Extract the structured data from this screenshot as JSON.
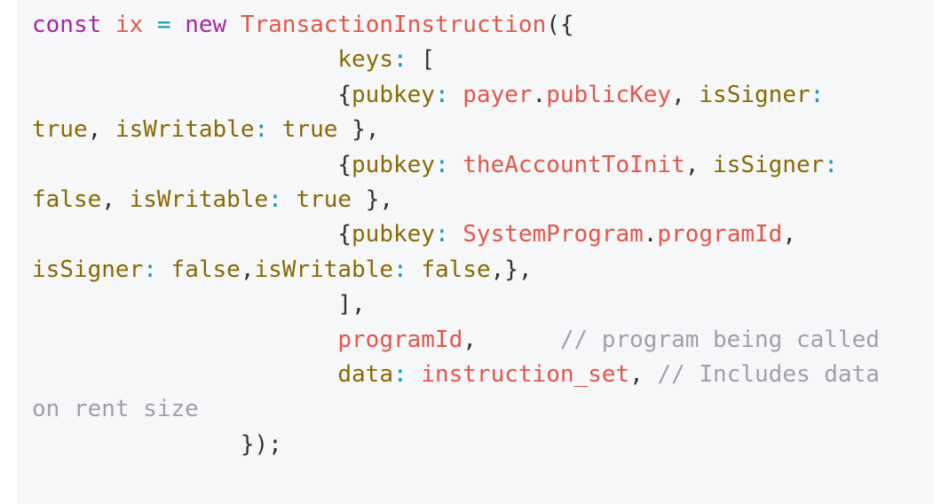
{
  "code": {
    "language": "javascript",
    "lines": [
      [
        {
          "t": "const",
          "c": "kw"
        },
        {
          "t": " ",
          "c": "punc"
        },
        {
          "t": "ix",
          "c": "var"
        },
        {
          "t": " ",
          "c": "punc"
        },
        {
          "t": "=",
          "c": "op"
        },
        {
          "t": " ",
          "c": "punc"
        },
        {
          "t": "new",
          "c": "kw"
        },
        {
          "t": " ",
          "c": "punc"
        },
        {
          "t": "TransactionInstruction",
          "c": "var"
        },
        {
          "t": "({",
          "c": "punc"
        }
      ],
      [
        {
          "t": "                      ",
          "c": "punc"
        },
        {
          "t": "keys",
          "c": "prop"
        },
        {
          "t": ":",
          "c": "op"
        },
        {
          "t": " [",
          "c": "punc"
        }
      ],
      [
        {
          "t": "                      ",
          "c": "punc"
        },
        {
          "t": "{",
          "c": "punc"
        },
        {
          "t": "pubkey",
          "c": "prop"
        },
        {
          "t": ":",
          "c": "op"
        },
        {
          "t": " ",
          "c": "punc"
        },
        {
          "t": "payer",
          "c": "var"
        },
        {
          "t": ".",
          "c": "punc"
        },
        {
          "t": "publicKey",
          "c": "var"
        },
        {
          "t": ", ",
          "c": "punc"
        },
        {
          "t": "isSigner",
          "c": "prop"
        },
        {
          "t": ":",
          "c": "op"
        }
      ],
      [
        {
          "t": "true",
          "c": "prop"
        },
        {
          "t": ", ",
          "c": "punc"
        },
        {
          "t": "isWritable",
          "c": "prop"
        },
        {
          "t": ":",
          "c": "op"
        },
        {
          "t": " ",
          "c": "punc"
        },
        {
          "t": "true",
          "c": "prop"
        },
        {
          "t": " },",
          "c": "punc"
        }
      ],
      [
        {
          "t": "                      ",
          "c": "punc"
        },
        {
          "t": "{",
          "c": "punc"
        },
        {
          "t": "pubkey",
          "c": "prop"
        },
        {
          "t": ":",
          "c": "op"
        },
        {
          "t": " ",
          "c": "punc"
        },
        {
          "t": "theAccountToInit",
          "c": "var"
        },
        {
          "t": ", ",
          "c": "punc"
        },
        {
          "t": "isSigner",
          "c": "prop"
        },
        {
          "t": ":",
          "c": "op"
        }
      ],
      [
        {
          "t": "false",
          "c": "prop"
        },
        {
          "t": ", ",
          "c": "punc"
        },
        {
          "t": "isWritable",
          "c": "prop"
        },
        {
          "t": ":",
          "c": "op"
        },
        {
          "t": " ",
          "c": "punc"
        },
        {
          "t": "true",
          "c": "prop"
        },
        {
          "t": " },",
          "c": "punc"
        }
      ],
      [
        {
          "t": "                      ",
          "c": "punc"
        },
        {
          "t": "{",
          "c": "punc"
        },
        {
          "t": "pubkey",
          "c": "prop"
        },
        {
          "t": ":",
          "c": "op"
        },
        {
          "t": " ",
          "c": "punc"
        },
        {
          "t": "SystemProgram",
          "c": "var"
        },
        {
          "t": ".",
          "c": "punc"
        },
        {
          "t": "programId",
          "c": "var"
        },
        {
          "t": ",",
          "c": "punc"
        }
      ],
      [
        {
          "t": "isSigner",
          "c": "prop"
        },
        {
          "t": ":",
          "c": "op"
        },
        {
          "t": " ",
          "c": "punc"
        },
        {
          "t": "false",
          "c": "prop"
        },
        {
          "t": ",",
          "c": "punc"
        },
        {
          "t": "isWritable",
          "c": "prop"
        },
        {
          "t": ":",
          "c": "op"
        },
        {
          "t": " ",
          "c": "punc"
        },
        {
          "t": "false",
          "c": "prop"
        },
        {
          "t": ",},",
          "c": "punc"
        }
      ],
      [
        {
          "t": "                      ",
          "c": "punc"
        },
        {
          "t": "],",
          "c": "punc"
        }
      ],
      [
        {
          "t": "                      ",
          "c": "punc"
        },
        {
          "t": "programId",
          "c": "var"
        },
        {
          "t": ",",
          "c": "punc"
        },
        {
          "t": "      ",
          "c": "punc"
        },
        {
          "t": "// program being called",
          "c": "cmt"
        }
      ],
      [
        {
          "t": "                      ",
          "c": "punc"
        },
        {
          "t": "data",
          "c": "prop"
        },
        {
          "t": ":",
          "c": "op"
        },
        {
          "t": " ",
          "c": "punc"
        },
        {
          "t": "instruction_set",
          "c": "var"
        },
        {
          "t": ", ",
          "c": "punc"
        },
        {
          "t": "// Includes data",
          "c": "cmt"
        }
      ],
      [
        {
          "t": "on rent size",
          "c": "cmt"
        }
      ],
      [
        {
          "t": "               ",
          "c": "punc"
        },
        {
          "t": "});",
          "c": "punc"
        }
      ]
    ]
  },
  "colors": {
    "background": "#f6f7f8",
    "keyword": "#a626a4",
    "identifier": "#e45649",
    "property": "#8a6a00",
    "operator": "#0a9bb5",
    "comment": "#a0a1a7",
    "text": "#333333"
  }
}
